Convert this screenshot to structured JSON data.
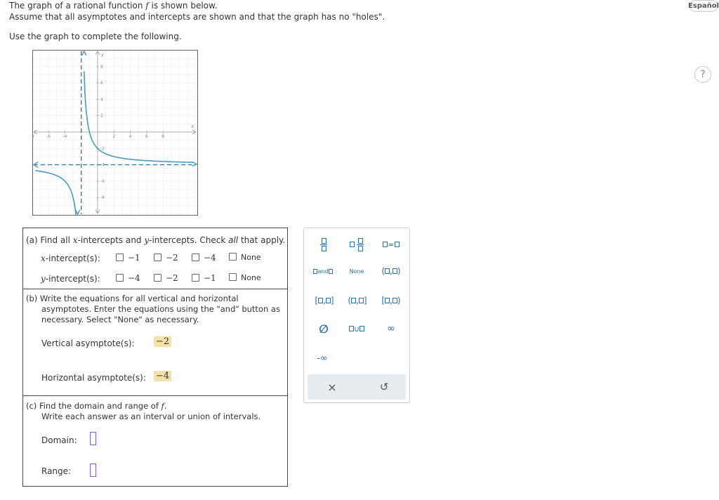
{
  "header": {
    "line1_a": "The graph of a rational function ",
    "line1_f": "f",
    "line1_b": " is shown below.",
    "line2": "Assume that all asymptotes and intercepts are shown and that the graph has no \"holes\".",
    "instruction": "Use the graph to complete the following."
  },
  "lang_button": "Español",
  "help_button": "?",
  "graph": {
    "x_label": "x",
    "y_label": "y",
    "x_ticks": [
      "-8",
      "-6",
      "-4",
      "2",
      "4",
      "6",
      "8"
    ],
    "y_ticks": [
      "8",
      "6",
      "4",
      "2",
      "-2",
      "-4",
      "-6",
      "-8"
    ],
    "vertical_asymptote": -2,
    "horizontal_asymptote": -4,
    "curve_color": "#4a9bbd",
    "asymptote_color": "#3f7aa3"
  },
  "part_a": {
    "prompt_a": "(a) Find all ",
    "prompt_x": "x",
    "prompt_b": "-intercepts and ",
    "prompt_y": "y",
    "prompt_c": "-intercepts. Check ",
    "prompt_all": "all",
    "prompt_d": " that apply.",
    "x_row_var": "x",
    "x_row_label": "-intercept(s):",
    "y_row_var": "y",
    "y_row_label": "-intercept(s):",
    "x_options": [
      "−1",
      "−2",
      "−4",
      "None"
    ],
    "y_options": [
      "−4",
      "−2",
      "−1",
      "None"
    ]
  },
  "part_b": {
    "prompt_line1": "(b) Write the equations for all vertical and horizontal",
    "prompt_line2": "asymptotes. Enter the equations using the \"and\" button as",
    "prompt_line3": "necessary. Select \"None\" as necessary.",
    "vertical_label": "Vertical asymptote(s):",
    "vertical_value": "−2",
    "horizontal_label": "Horizontal asymptote(s):",
    "horizontal_value": "−4"
  },
  "part_c": {
    "prompt_a": "(c) Find the domain and range of ",
    "prompt_f": "f",
    "prompt_b": ".",
    "prompt_line2": "Write each answer as an interval or union of intervals.",
    "domain_label": "Domain:",
    "range_label": "Range:"
  },
  "palette": {
    "and_label": "and",
    "none_label": "None",
    "empty_set": "∅",
    "union": "∪",
    "infinity": "∞",
    "neg_infinity": "-∞",
    "clear": "×",
    "undo": "↺"
  }
}
